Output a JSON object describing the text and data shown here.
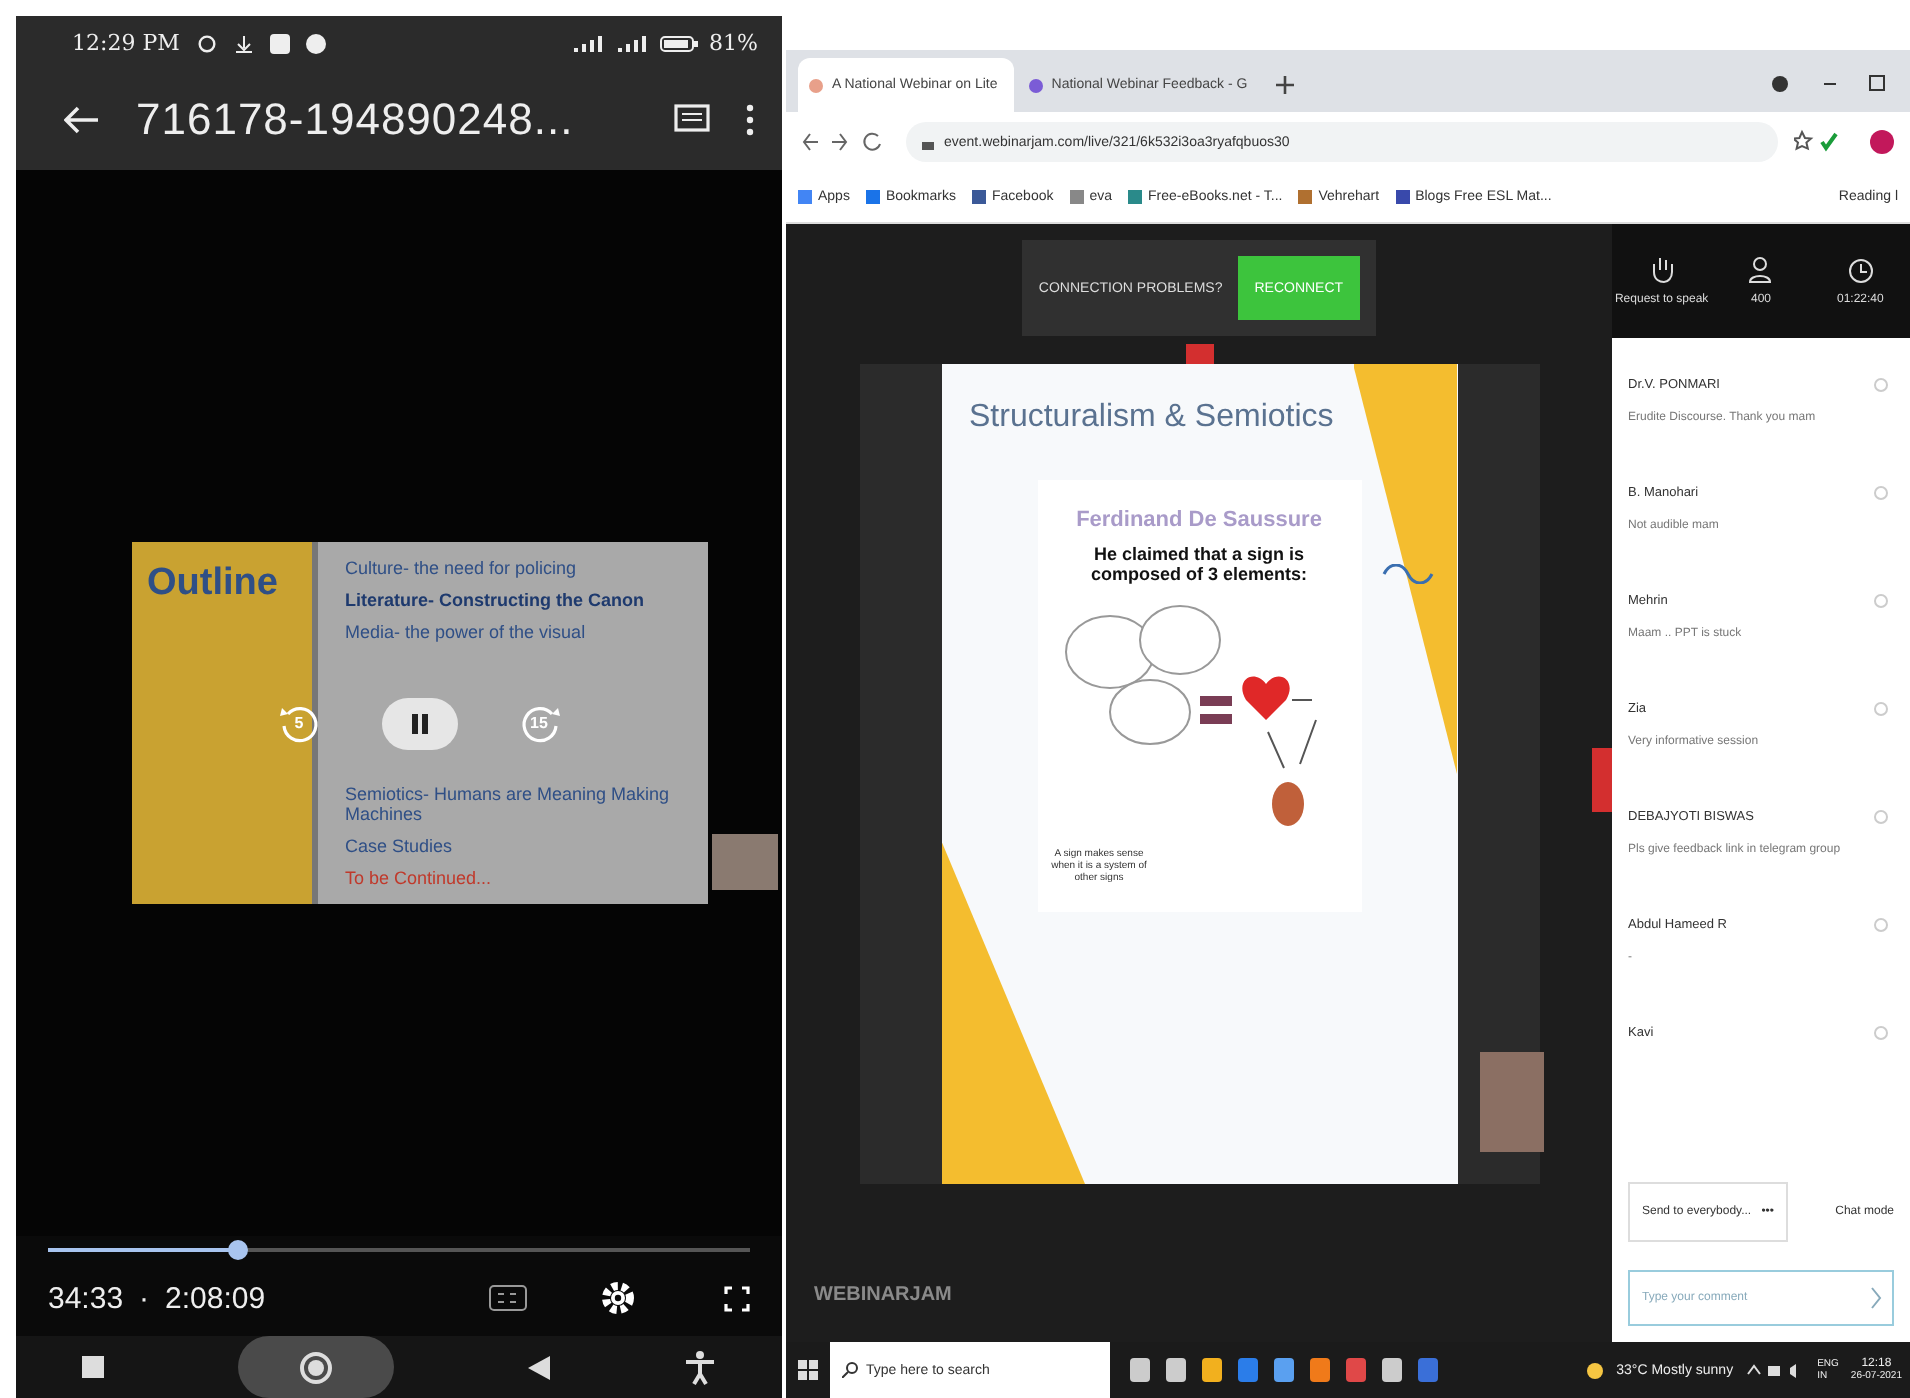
{
  "phone": {
    "status_bar": {
      "time": "12:29 PM",
      "battery": "81%"
    },
    "title": "716178-194890248...",
    "slide": {
      "heading": "Outline",
      "items": [
        {
          "text": "Culture- the need for policing",
          "color": "#2f4f86"
        },
        {
          "text": "Literature- Constructing the Canon",
          "color": "#1e3a6e"
        },
        {
          "text": "Media- the power of the visual",
          "color": "#2f4f86"
        },
        {
          "text": "Semiotics- Humans are Meaning Making Machines",
          "color": "#2f4f86"
        },
        {
          "text": "Case Studies",
          "color": "#2f4f86"
        },
        {
          "text": "To be Continued...",
          "color": "#c0392b"
        }
      ]
    },
    "rewind_label": "5",
    "forward_label": "15",
    "playing": true,
    "progress": {
      "level": 0.27
    },
    "elapsed": "34:33",
    "separator": "·",
    "duration": "2:08:09"
  },
  "browser": {
    "tabs": [
      {
        "label": "A National Webinar on Lite",
        "selected": true
      },
      {
        "label": "National Webinar Feedback - G",
        "selected": false
      }
    ],
    "url": "event.webinarjam.com/live/321/6k532i3oa3ryafqbuos30",
    "bookmarks": [
      "Apps",
      "Bookmarks",
      "Facebook",
      "eva",
      "Free-eBooks.net - T...",
      "Vehrehart",
      "Blogs Free ESL Mat..."
    ],
    "reading_list": "Reading l",
    "webinar": {
      "connection_text": "CONNECTION PROBLEMS?",
      "reconnect": "RECONNECT",
      "slide": {
        "title": "Structuralism & Semiotics",
        "subtitle": "Ferdinand De Saussure",
        "claim": "He claimed that a sign is composed of 3 elements:",
        "note": "A sign makes sense when it is a system of other signs"
      },
      "logo": "WEBINARJAM",
      "chat": {
        "request": "Request to speak",
        "attendees": "400",
        "timer": "01:22:40",
        "messages": [
          {
            "name": "Dr.V. PONMARI",
            "text": "Erudite Discourse. Thank you mam"
          },
          {
            "name": "B. Manohari",
            "text": "Not audible mam"
          },
          {
            "name": "Mehrin",
            "text": "Maam .. PPT is stuck"
          },
          {
            "name": "Zia",
            "text": "Very informative session"
          },
          {
            "name": "DEBAJYOTI BISWAS",
            "text": "Pls give feedback link in telegram group"
          },
          {
            "name": "Abdul Hameed R",
            "text": "-"
          },
          {
            "name": "Kavi"
          }
        ],
        "send_to": "Send to everybody...",
        "send_more": "•••",
        "chat_mode": "Chat mode",
        "comment_placeholder": "Type your comment"
      }
    },
    "taskbar": {
      "search_placeholder": "Type here to search",
      "weather": "33°C Mostly sunny",
      "lang": "ENG",
      "region": "IN",
      "time": "12:18",
      "date": "26-07-2021"
    }
  }
}
